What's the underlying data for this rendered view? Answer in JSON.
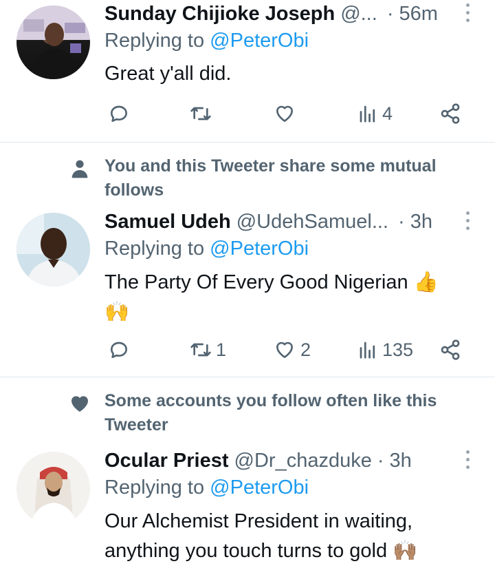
{
  "tweets": [
    {
      "name": "Sunday Chijioke Joseph",
      "handle": "@...",
      "time": "· 56m",
      "replying_prefix": "Replying to",
      "replying_to": "@PeterObi",
      "text_lines": [
        "Great y'all did."
      ],
      "counts": {
        "replies": "",
        "retweets": "",
        "likes": "",
        "views": "4"
      },
      "icons": [
        "reply-icon",
        "retweet-icon",
        "heart-icon",
        "views-icon",
        "share-icon"
      ]
    },
    {
      "social_context": "You and this Tweeter share some mutual follows",
      "social_icon": "person-icon",
      "name": "Samuel Udeh",
      "handle": "@UdehSamuel...",
      "time": "· 3h",
      "replying_prefix": "Replying to",
      "replying_to": "@PeterObi",
      "text_lines": [
        "The Party Of Every Good Nigerian 👍",
        "🙌"
      ],
      "counts": {
        "replies": "",
        "retweets": "1",
        "likes": "2",
        "views": "135"
      }
    },
    {
      "social_context": "Some accounts you follow often like this Tweeter",
      "social_icon": "heart-filled-icon",
      "name": "Ocular Priest",
      "handle": "@Dr_chazduke",
      "time": "· 3h",
      "replying_prefix": "Replying to",
      "replying_to": "@PeterObi",
      "text_lines": [
        "Our Alchemist President in waiting,",
        "anything you touch turns to gold 🙌🏽"
      ]
    }
  ],
  "colors": {
    "link": "#1d9bf0",
    "secondary": "#536471",
    "text": "#0f1419",
    "divider": "#e1e8ed"
  }
}
